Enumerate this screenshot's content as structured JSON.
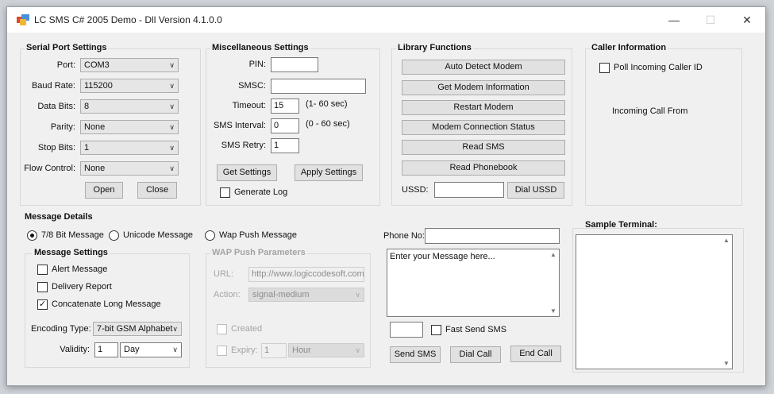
{
  "window": {
    "title": "LC SMS C# 2005 Demo - Dll Version 4.1.0.0",
    "minimize": "—",
    "maximize": "☐",
    "close": "✕"
  },
  "serial": {
    "title": "Serial Port Settings",
    "port_label": "Port:",
    "port_value": "COM3",
    "baud_label": "Baud Rate:",
    "baud_value": "115200",
    "databits_label": "Data Bits:",
    "databits_value": "8",
    "parity_label": "Parity:",
    "parity_value": "None",
    "stopbits_label": "Stop Bits:",
    "stopbits_value": "1",
    "flow_label": "Flow Control:",
    "flow_value": "None",
    "open_label": "Open",
    "close_label": "Close"
  },
  "misc": {
    "title": "Miscellaneous Settings",
    "pin_label": "PIN:",
    "pin_value": "",
    "smsc_label": "SMSC:",
    "smsc_value": "",
    "timeout_label": "Timeout:",
    "timeout_value": "15",
    "timeout_hint": "(1- 60 sec)",
    "interval_label": "SMS Interval:",
    "interval_value": "0",
    "interval_hint": "(0 - 60 sec)",
    "retry_label": "SMS Retry:",
    "retry_value": "1",
    "get_label": "Get Settings",
    "apply_label": "Apply Settings",
    "genlog_label": "Generate Log"
  },
  "library": {
    "title": "Library Functions",
    "auto_detect": "Auto Detect Modem",
    "get_info": "Get Modem Information",
    "restart": "Restart Modem",
    "conn_status": "Modem Connection Status",
    "read_sms": "Read SMS",
    "read_phonebook": "Read Phonebook",
    "ussd_label": "USSD:",
    "ussd_value": "",
    "dial_ussd": "Dial USSD"
  },
  "caller": {
    "title": "Caller Information",
    "poll_label": "Poll Incoming Caller ID",
    "incoming_label": "Incoming Call From"
  },
  "message": {
    "title": "Message Details",
    "radio_78": "7/8 Bit Message",
    "radio_unicode": "Unicode Message",
    "radio_wap": "Wap Push Message",
    "settings_title": "Message Settings",
    "alert": "Alert Message",
    "delivery": "Delivery Report",
    "concat": "Concatenate Long Message",
    "encoding_label": "Encoding Type:",
    "encoding_value": "7-bit GSM Alphabet",
    "validity_label": "Validity:",
    "validity_value": "1",
    "validity_unit": "Day"
  },
  "wap": {
    "title": "WAP Push Parameters",
    "url_label": "URL:",
    "url_value": "http://www.logiccodesoft.com",
    "action_label": "Action:",
    "action_value": "signal-medium",
    "created_label": "Created",
    "expiry_label": "Expiry:",
    "expiry_value": "1",
    "expiry_unit": "Hour"
  },
  "sms": {
    "phone_label": "Phone No:",
    "phone_value": "",
    "message_placeholder": "Enter your Message here...",
    "fast_value": "",
    "fast_label": "Fast Send SMS",
    "send_label": "Send SMS",
    "dial_label": "Dial Call",
    "end_label": "End Call"
  },
  "terminal": {
    "title": "Sample Terminal:"
  }
}
